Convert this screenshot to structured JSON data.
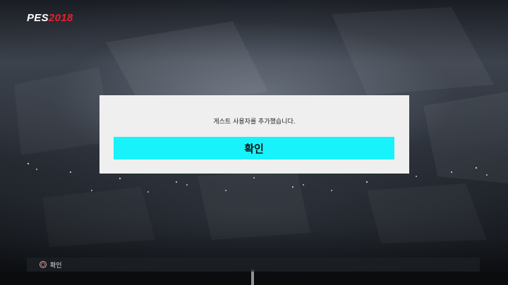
{
  "logo": {
    "brand": "PES",
    "year": "2018"
  },
  "dialog": {
    "message": "게스트 사용자를 추가했습니다.",
    "confirm_label": "확인"
  },
  "footer": {
    "hint_icon": "circle-button-icon",
    "hint_label": "확인"
  },
  "colors": {
    "accent": "#18f3fb",
    "logo_year": "#e8202a",
    "dialog_bg": "#efefef"
  }
}
